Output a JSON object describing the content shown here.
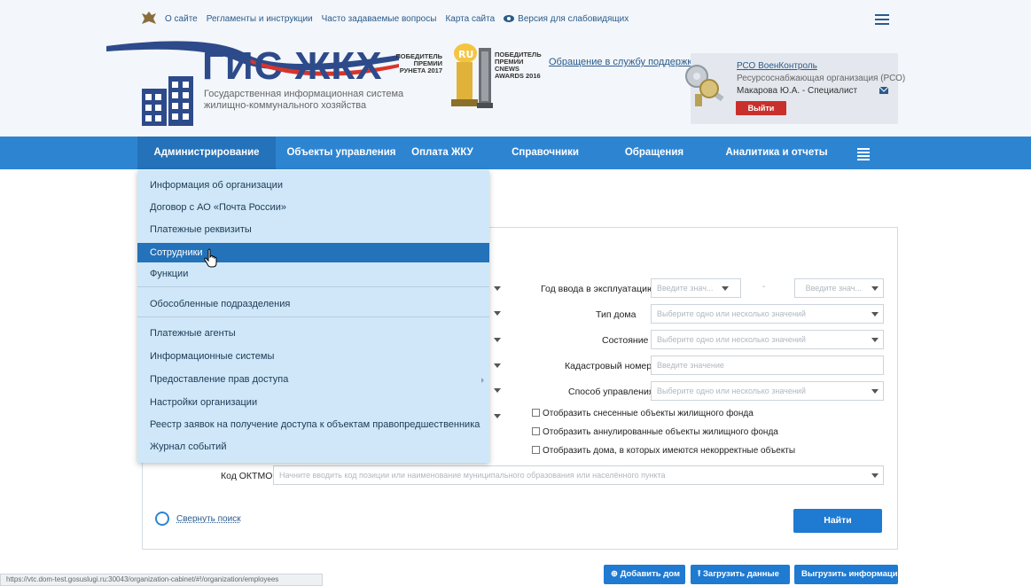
{
  "topbar": {
    "links": [
      "О сайте",
      "Регламенты и инструкции",
      "Часто задаваемые вопросы",
      "Карта сайта"
    ],
    "accessibility": "Версия для слабовидящих"
  },
  "header": {
    "logo_title": "ГИС ЖКХ",
    "logo_subtitle": "Государственная информационная система жилищно-коммунального хозяйства",
    "award1": "ПОБЕДИТЕЛЬ ПРЕМИИ РУНЕТА 2017",
    "award1_badge": "RU",
    "award2": "ПОБЕДИТЕЛЬ ПРЕМИИ CNEWS AWARDS 2016",
    "support_link": "Обращение в службу поддержки",
    "user": {
      "org": "РСО ВоенКонтроль",
      "org_type": "Ресурсоснабжающая организация (РСО)",
      "name": "Макарова Ю.А. - Специалист",
      "logout": "Выйти"
    }
  },
  "nav": {
    "items": [
      "Администрирование",
      "Объекты управления",
      "Оплата ЖКУ",
      "Справочники",
      "Обращения",
      "Аналитика и отчеты"
    ]
  },
  "dropdown": {
    "items": [
      "Информация об организации",
      "Договор с АО «Почта России»",
      "Платежные реквизиты",
      "Сотрудники",
      "Функции",
      "Обособленные подразделения",
      "Платежные агенты",
      "Информационные системы",
      "Предоставление прав доступа",
      "Настройки организации",
      "Реестр заявок на получение доступа к объектам правопредшественника",
      "Журнал событий"
    ]
  },
  "filters": {
    "year_label": "Год ввода в эксплуатацию",
    "year_from": "Введите знач...",
    "year_to": "Введите знач...",
    "house_type_label": "Тип дома",
    "house_type_ph": "Выберите одно или несколько значений",
    "state_label": "Состояние",
    "state_ph": "Выберите одно или несколько значений",
    "cadastral_label": "Кадастровый номер",
    "cadastral_ph": "Введите значение",
    "mgmt_label": "Способ управления",
    "mgmt_ph": "Выберите одно или несколько значений",
    "check1": "Отобразить снесенные объекты жилищного фонда",
    "check2": "Отобразить аннулированные объекты жилищного фонда",
    "check3": "Отобразить дома, в которых имеются некорректные объекты",
    "oktmo_label": "Код ОКТМО",
    "oktmo_ph": "Начните вводить код позиции или наименование муниципального образования или населённого пункта",
    "collapse": "Свернуть поиск",
    "find": "Найти"
  },
  "actions": {
    "add_house": "Добавить дом",
    "upload": "Загрузить данные",
    "export": "Выгрузить информацию"
  },
  "status_url": "https://vtc.dom-test.gosuslugi.ru:30043/organization-cabinet/#!/organization/employees"
}
